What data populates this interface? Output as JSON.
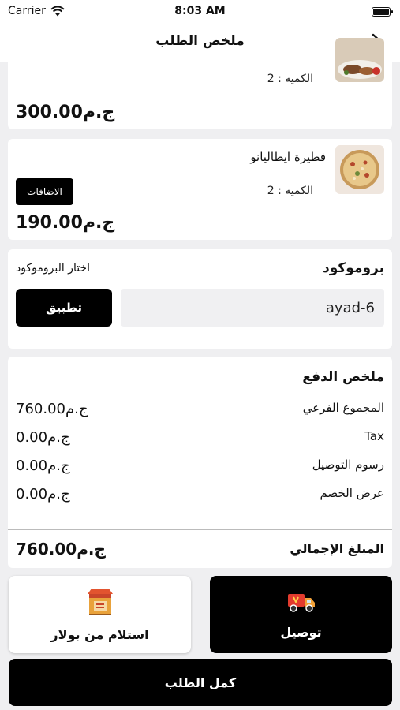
{
  "status_bar": {
    "carrier": "Carrier",
    "time": "8:03 AM"
  },
  "nav": {
    "title": "ملخص الطلب"
  },
  "items": [
    {
      "name": "",
      "quantity": "الكميه : 2",
      "price": "300.00ج.م"
    },
    {
      "name": "فطيرة ايطاليانو",
      "quantity": "الكميه : 2",
      "price": "190.00ج.م",
      "addons_label": "الاضافات"
    }
  ],
  "promo": {
    "title": "بروموكود",
    "hint": "اختار البروموكود",
    "value": "ayad-6",
    "apply_label": "تطبيق"
  },
  "summary": {
    "title": "ملخص الدفع",
    "rows": [
      {
        "label": "المجموع الفرعي",
        "value": "760.00ج.م"
      },
      {
        "label": "Tax",
        "value": "0.00ج.م"
      },
      {
        "label": "رسوم التوصيل",
        "value": "0.00ج.م"
      },
      {
        "label": "عرض الخصم",
        "value": "0.00ج.م"
      }
    ],
    "total_label": "المبلغ الإجمالي",
    "total_value": "760.00ج.م"
  },
  "methods": {
    "delivery_label": "توصيل",
    "delivery_icon": "delivery-truck-icon",
    "pickup_label": "استلام من بولار",
    "pickup_icon": "store-icon"
  },
  "complete_label": "كمل الطلب"
}
